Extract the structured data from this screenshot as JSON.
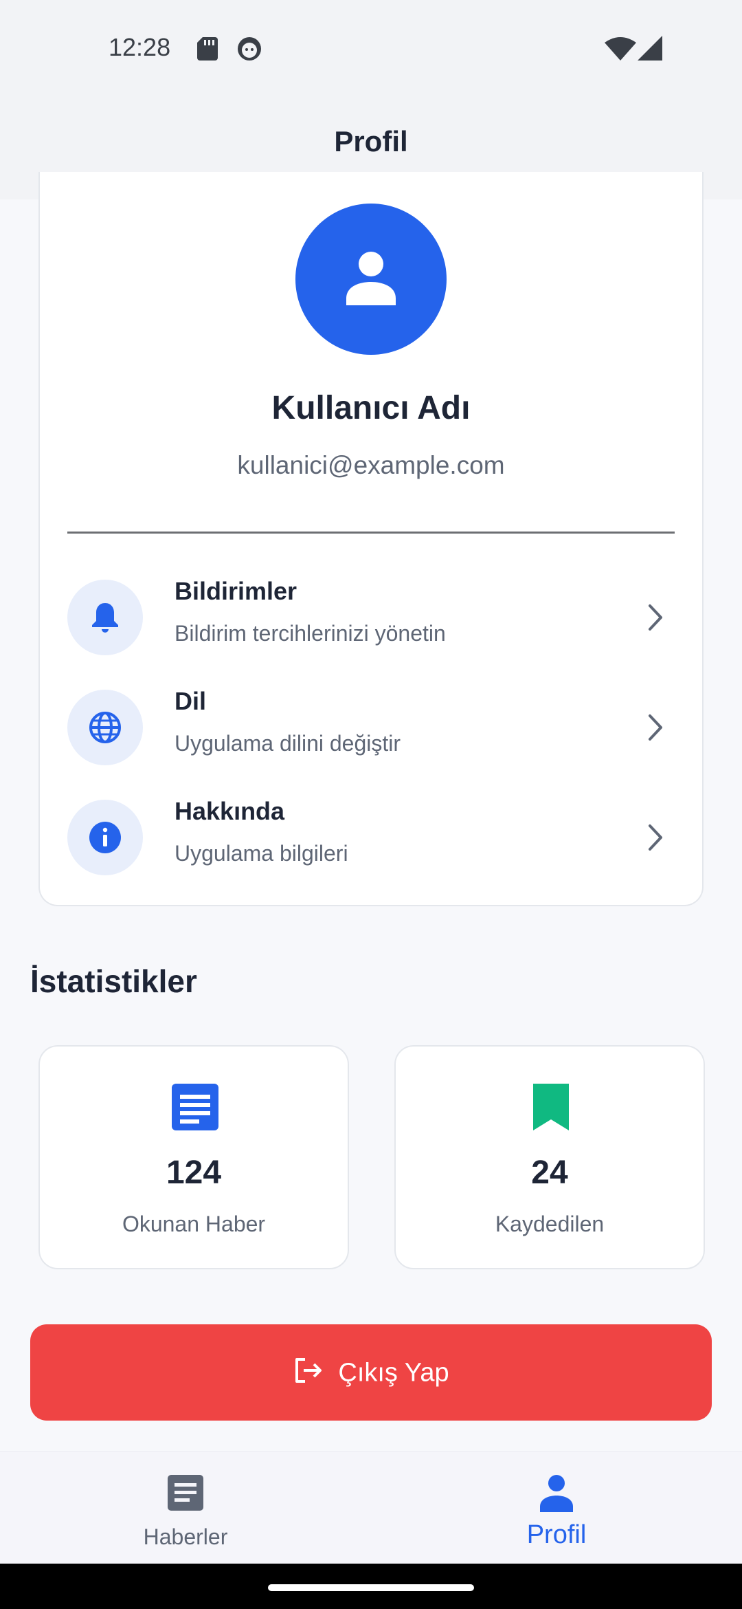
{
  "status_bar": {
    "time": "12:28",
    "icons": [
      "sd-card-icon",
      "face-icon",
      "wifi-icon",
      "signal-icon"
    ]
  },
  "app_bar": {
    "title": "Profil"
  },
  "profile": {
    "avatar_icon": "person-icon",
    "name": "Kullanıcı Adı",
    "email": "kullanici@example.com"
  },
  "menu": {
    "items": [
      {
        "icon": "bell-icon",
        "title": "Bildirimler",
        "subtitle": "Bildirim tercihlerinizi yönetin"
      },
      {
        "icon": "globe-icon",
        "title": "Dil",
        "subtitle": "Uygulama dilini değiştir"
      },
      {
        "icon": "info-icon",
        "title": "Hakkında",
        "subtitle": "Uygulama bilgileri"
      }
    ]
  },
  "stats": {
    "title": "İstatistikler",
    "items": [
      {
        "icon": "article-icon",
        "value": "124",
        "label": "Okunan Haber",
        "color": "#2563EB"
      },
      {
        "icon": "bookmark-icon",
        "value": "24",
        "label": "Kaydedilen",
        "color": "#10B981"
      }
    ]
  },
  "logout": {
    "label": "Çıkış Yap",
    "icon": "logout-icon",
    "color": "#EF4444"
  },
  "bottom_nav": {
    "items": [
      {
        "label": "Haberler",
        "icon": "article-icon",
        "active": false
      },
      {
        "label": "Profil",
        "icon": "person-icon",
        "active": true
      }
    ]
  },
  "theme": {
    "primary": "#2563EB",
    "danger": "#EF4444",
    "success": "#10B981"
  }
}
